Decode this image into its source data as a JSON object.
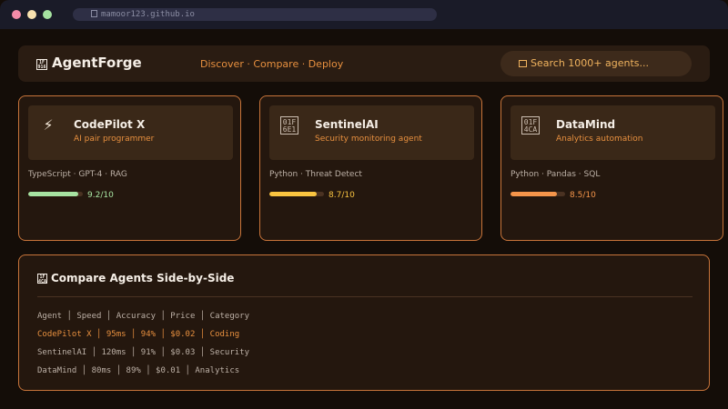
{
  "browser": {
    "url": "mamoor123.github.io",
    "dots": [
      "#f38ba8",
      "#f9e2af",
      "#a6e3a1"
    ]
  },
  "header": {
    "logo_glyph": "1F\n916",
    "app_name": "AgentForge",
    "nav_text": "Discover · Compare · Deploy",
    "search_placeholder": "Search 1000+ agents..."
  },
  "cards": [
    {
      "name": "CodePilot X",
      "subtitle": "AI pair programmer",
      "icon": "⚡",
      "tags": "TypeScript · GPT-4 · RAG",
      "score_text": "9.2/10",
      "score": 9.2,
      "color": "#a6e3a1"
    },
    {
      "name": "SentinelAI",
      "subtitle": "Security monitoring agent",
      "icon": "01F\n6E1",
      "tags": "Python · Threat Detect",
      "score_text": "8.7/10",
      "score": 8.7,
      "color": "#f9c440"
    },
    {
      "name": "DataMind",
      "subtitle": "Analytics automation",
      "icon": "01F\n4CA",
      "tags": "Python · Pandas · SQL",
      "score_text": "8.5/10",
      "score": 8.5,
      "color": "#f5954a"
    }
  ],
  "compare": {
    "glyph": "1F\n4CA",
    "title": "Compare Agents Side-by-Side",
    "rows": [
      "Agent │ Speed │ Accuracy │ Price │ Category",
      "CodePilot X │ 95ms │ 94% │ $0.02 │ Coding",
      "SentinelAI │ 120ms │ 91% │ $0.03 │ Security",
      "DataMind │ 80ms │ 89% │ $0.01 │ Analytics"
    ]
  },
  "colors": {
    "accent": "#e8903f",
    "border": "#c8743a",
    "background": "#140d08"
  }
}
